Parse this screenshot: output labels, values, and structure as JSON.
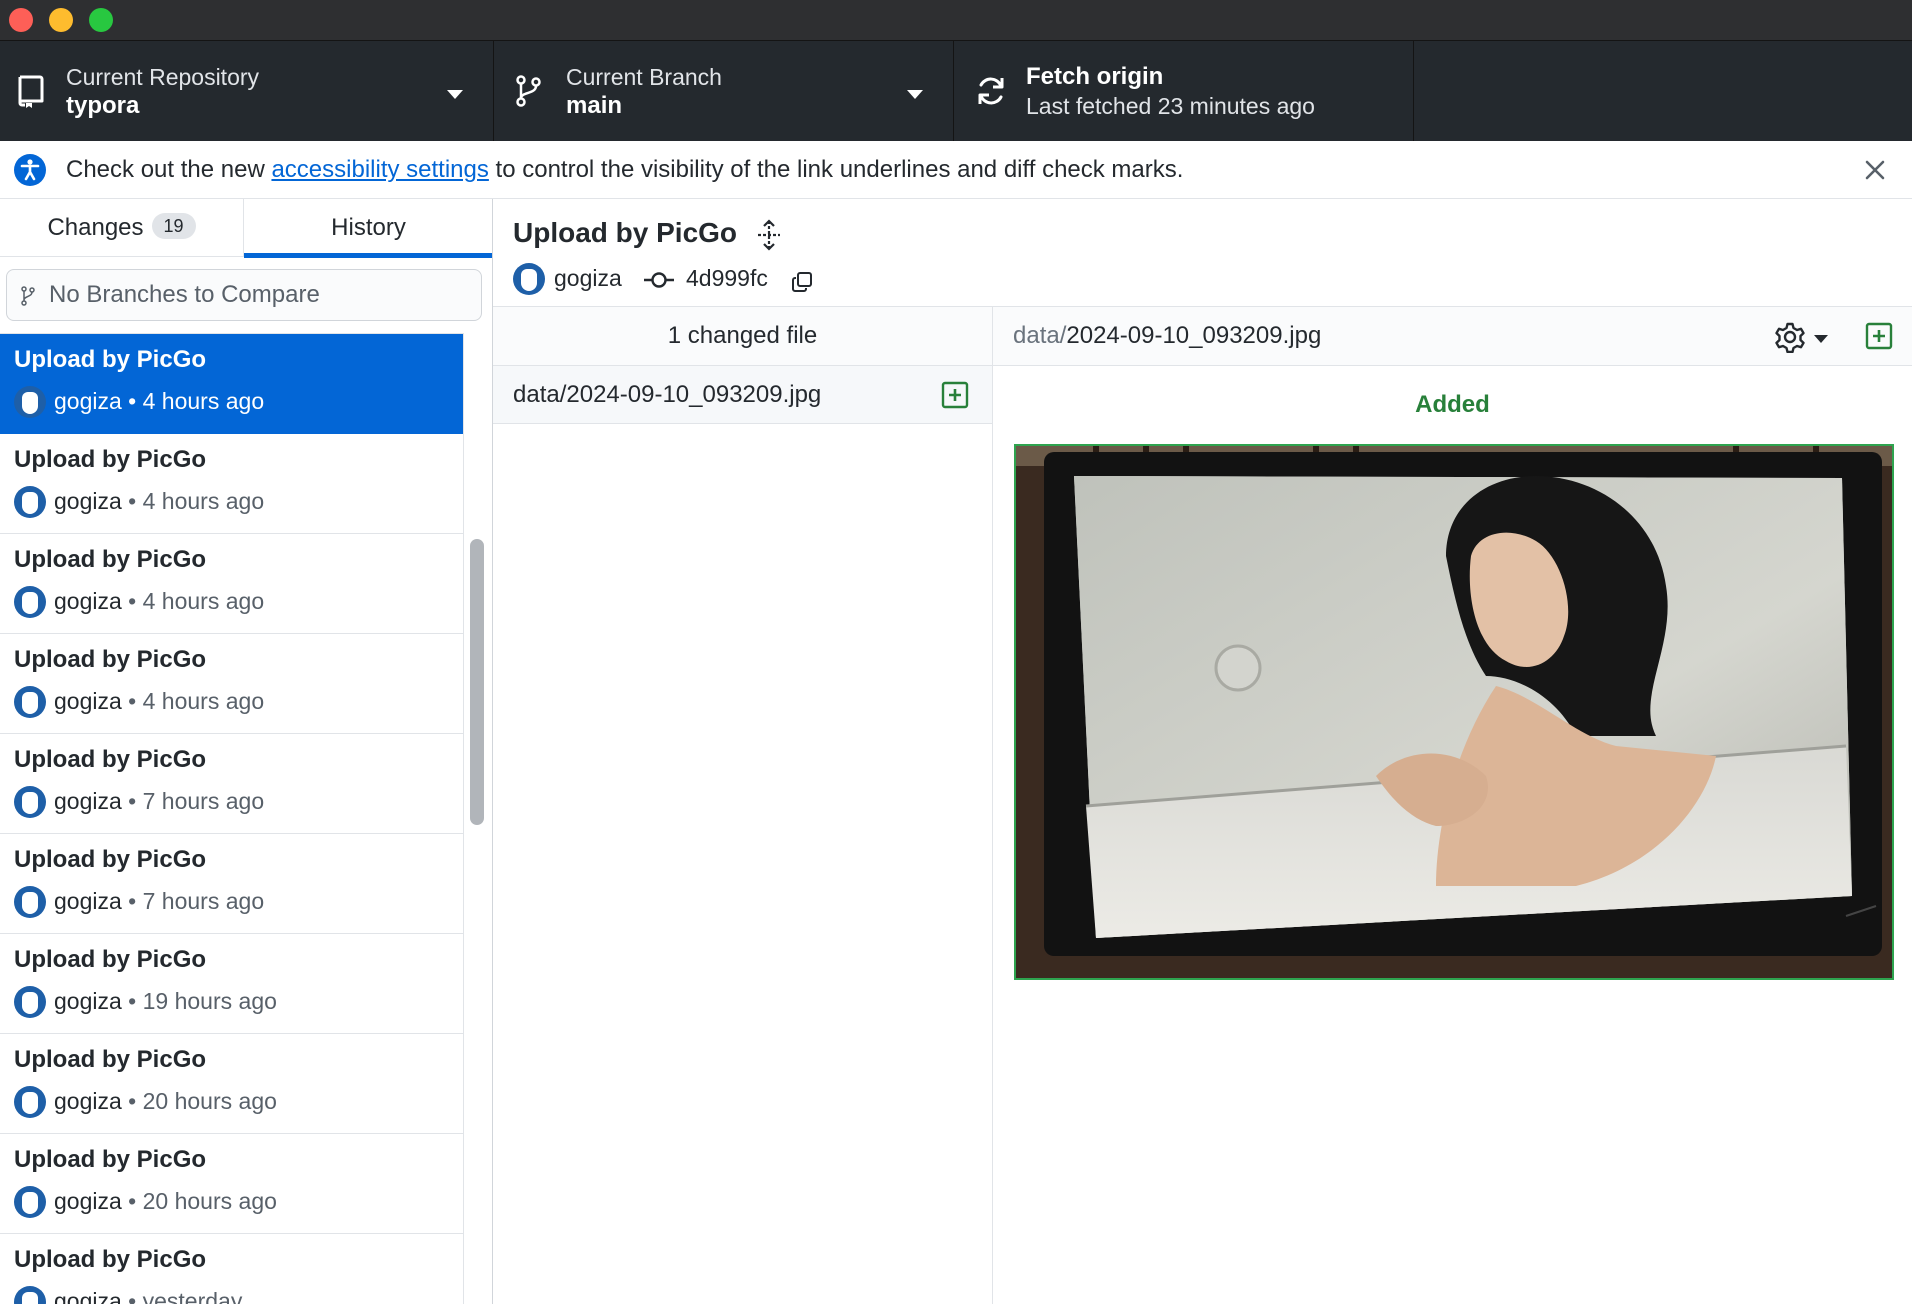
{
  "toolbar": {
    "repository": {
      "title": "Current Repository",
      "value": "typora"
    },
    "branch": {
      "title": "Current Branch",
      "value": "main"
    },
    "fetch": {
      "title": "Fetch origin",
      "value": "Last fetched 23 minutes ago"
    }
  },
  "banner": {
    "prefix": "Check out the new ",
    "link": "accessibility settings",
    "suffix": " to control the visibility of the link underlines and diff check marks."
  },
  "sidebar": {
    "tabs": {
      "changes": "Changes",
      "changes_count": "19",
      "history": "History"
    },
    "compare_placeholder": "No Branches to Compare",
    "commits": [
      {
        "title": "Upload by PicGo",
        "author": "gogiza",
        "time": "4 hours ago",
        "selected": true
      },
      {
        "title": "Upload by PicGo",
        "author": "gogiza",
        "time": "4 hours ago"
      },
      {
        "title": "Upload by PicGo",
        "author": "gogiza",
        "time": "4 hours ago"
      },
      {
        "title": "Upload by PicGo",
        "author": "gogiza",
        "time": "4 hours ago"
      },
      {
        "title": "Upload by PicGo",
        "author": "gogiza",
        "time": "7 hours ago"
      },
      {
        "title": "Upload by PicGo",
        "author": "gogiza",
        "time": "7 hours ago"
      },
      {
        "title": "Upload by PicGo",
        "author": "gogiza",
        "time": "19 hours ago"
      },
      {
        "title": "Upload by PicGo",
        "author": "gogiza",
        "time": "20 hours ago"
      },
      {
        "title": "Upload by PicGo",
        "author": "gogiza",
        "time": "20 hours ago"
      },
      {
        "title": "Upload by PicGo",
        "author": "gogiza",
        "time": "yesterday"
      }
    ]
  },
  "commit": {
    "summary": "Upload by PicGo",
    "author": "gogiza",
    "sha": "4d999fc",
    "changed_files_label": "1 changed file",
    "files": [
      {
        "path": "data/2024-09-10_093209.jpg",
        "status": "added"
      }
    ]
  },
  "diff": {
    "dir": "data/",
    "filename": "2024-09-10_093209.jpg",
    "status_label": "Added"
  },
  "colors": {
    "accent": "#0366d6",
    "toolbar_bg": "#24292e",
    "added_green": "#28803a"
  }
}
